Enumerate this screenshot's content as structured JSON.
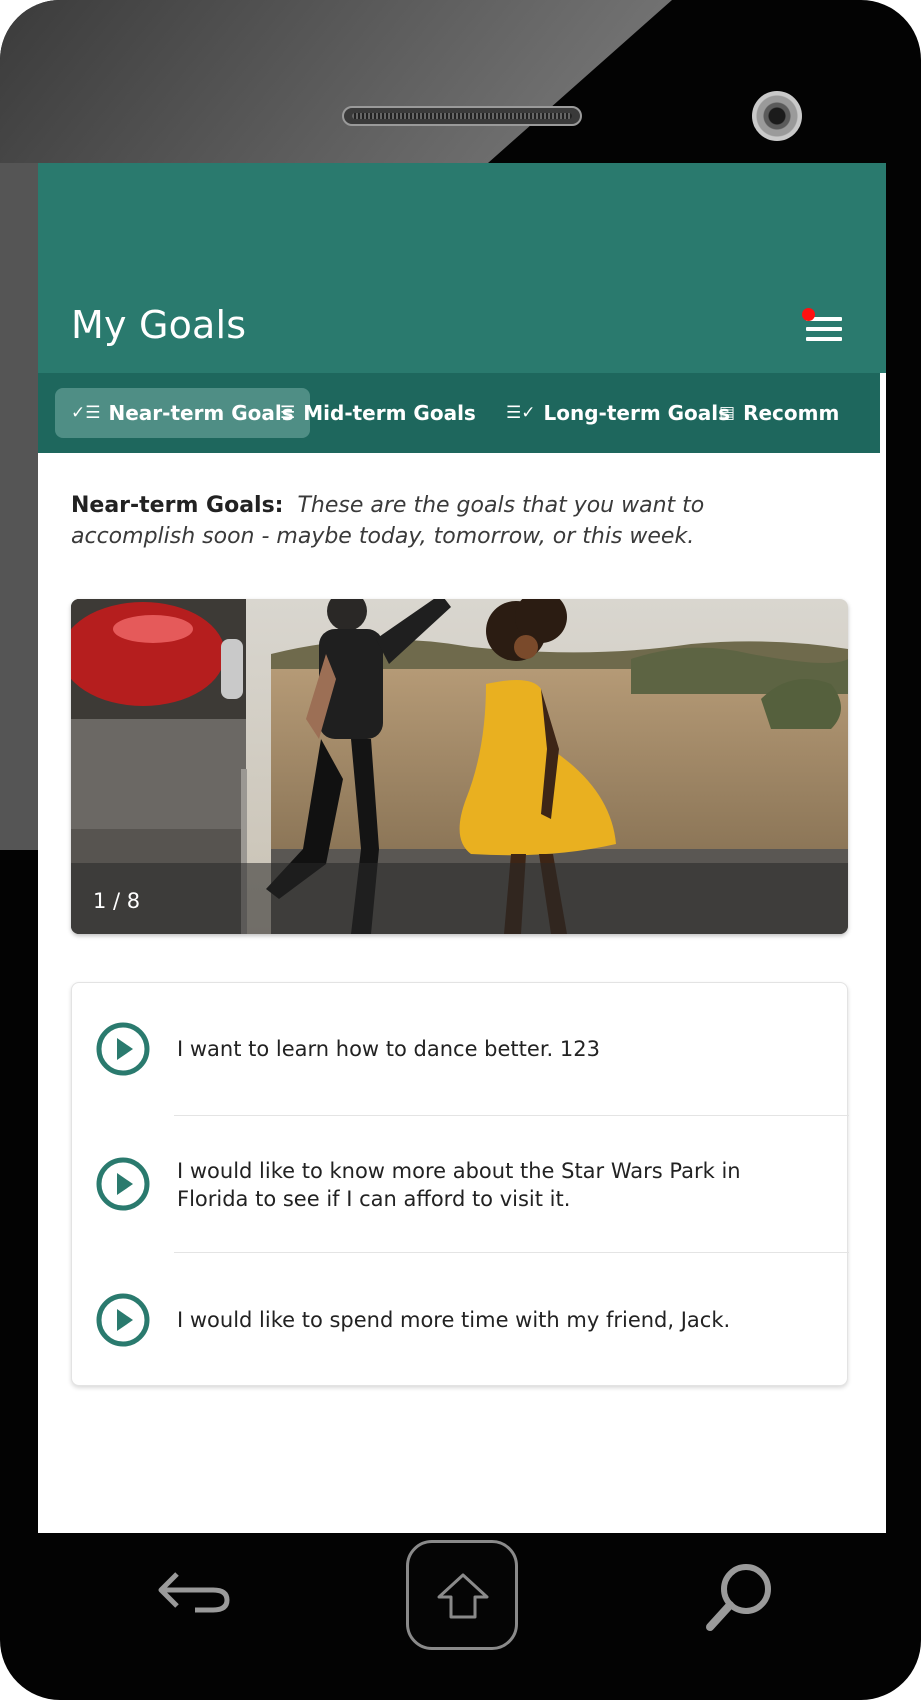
{
  "app": {
    "title": "My Goals",
    "accent_color": "#2a7a6e",
    "tabbar_color": "#1e675d",
    "notification_color": "#ff1010"
  },
  "menu": {
    "icon": "hamburger-menu-icon",
    "has_notification": true
  },
  "tabs": [
    {
      "label": "Near-term Goals",
      "icon": "checklist-icon",
      "active": true
    },
    {
      "label": "Mid-term Goals",
      "icon": "list-icon",
      "active": false
    },
    {
      "label": "Long-term Goals",
      "icon": "checklist-done-icon",
      "active": false
    },
    {
      "label": "Recomm",
      "icon": "document-list-icon",
      "active": false
    }
  ],
  "intro": {
    "heading": "Near-term Goals:",
    "description": "These are the goals that you want to accomplish soon - maybe today, tomorrow, or this week."
  },
  "carousel": {
    "counter": "1 / 8",
    "current": 1,
    "total": 8,
    "image_description": "man and woman in yellow dress dancing outdoors"
  },
  "goals": [
    {
      "text": "I want to learn how to dance better. 123",
      "icon": "play-circle-icon"
    },
    {
      "text": "I would like to know more about the Star Wars Park in Florida to see if I can afford to visit it.",
      "icon": "play-circle-icon"
    },
    {
      "text": "I would like to spend more time with my friend, Jack.",
      "icon": "play-circle-icon"
    }
  ],
  "device_nav": {
    "back_icon": "back-arrow-icon",
    "home_icon": "home-icon",
    "search_icon": "search-icon"
  }
}
